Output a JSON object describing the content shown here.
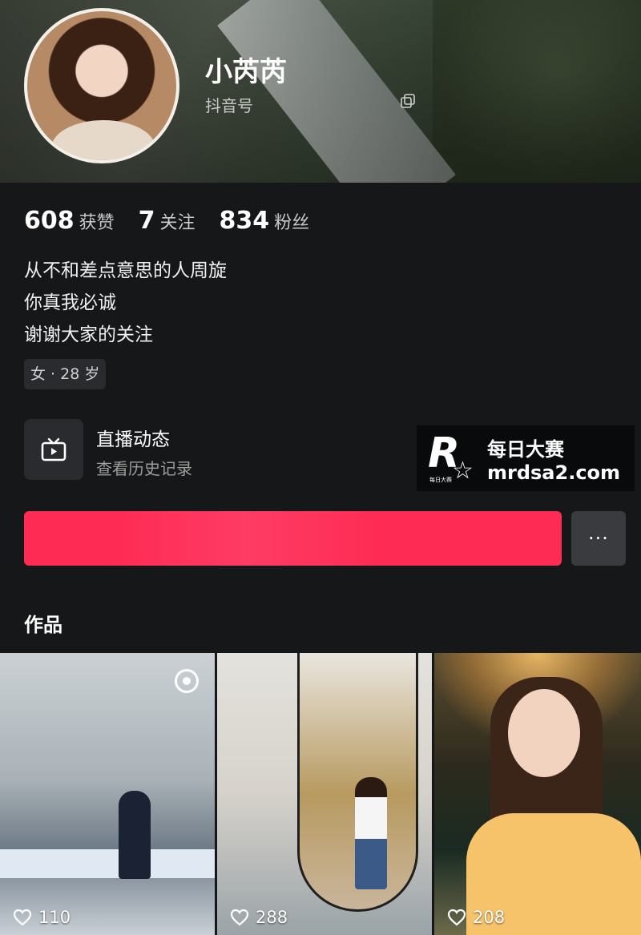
{
  "profile": {
    "username": "小芮芮",
    "douyin_id_label": "抖音号"
  },
  "stats": [
    {
      "value": "608",
      "label": "获赞"
    },
    {
      "value": "7",
      "label": "关注"
    },
    {
      "value": "834",
      "label": "粉丝"
    }
  ],
  "bio": {
    "line1": "从不和差点意思的人周旋",
    "line2": "你真我必诚",
    "line3": "谢谢大家的关注"
  },
  "tag": "女 · 28 岁",
  "live": {
    "title": "直播动态",
    "subtitle": "查看历史记录"
  },
  "watermark": {
    "logo_letter": "R",
    "logo_small": "每日大赛",
    "title": "每日大赛",
    "url": "mrdsa2.com"
  },
  "buttons": {
    "more": "···"
  },
  "works": {
    "label": "作品",
    "items": [
      {
        "likes": "110"
      },
      {
        "likes": "288"
      },
      {
        "likes": "208"
      }
    ]
  },
  "colors": {
    "accent": "#fe2c55",
    "background": "#161719"
  }
}
